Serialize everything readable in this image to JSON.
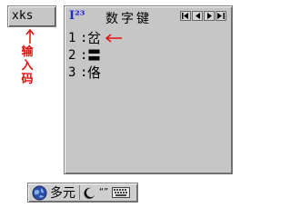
{
  "input": {
    "code": "xks"
  },
  "input_label": {
    "text": "输入码"
  },
  "candidate_window": {
    "title": "数字键",
    "logo": "I²³",
    "candidates": [
      {
        "num": "1",
        "char": "岔"
      },
      {
        "num": "2",
        "char": "〓"
      },
      {
        "num": "3",
        "char": "佫"
      }
    ]
  },
  "ime_bar": {
    "mode_label": "多元",
    "punct_label": "“”"
  },
  "colors": {
    "annotation_red": "#e01010",
    "logo_blue": "#1a2ad6"
  }
}
